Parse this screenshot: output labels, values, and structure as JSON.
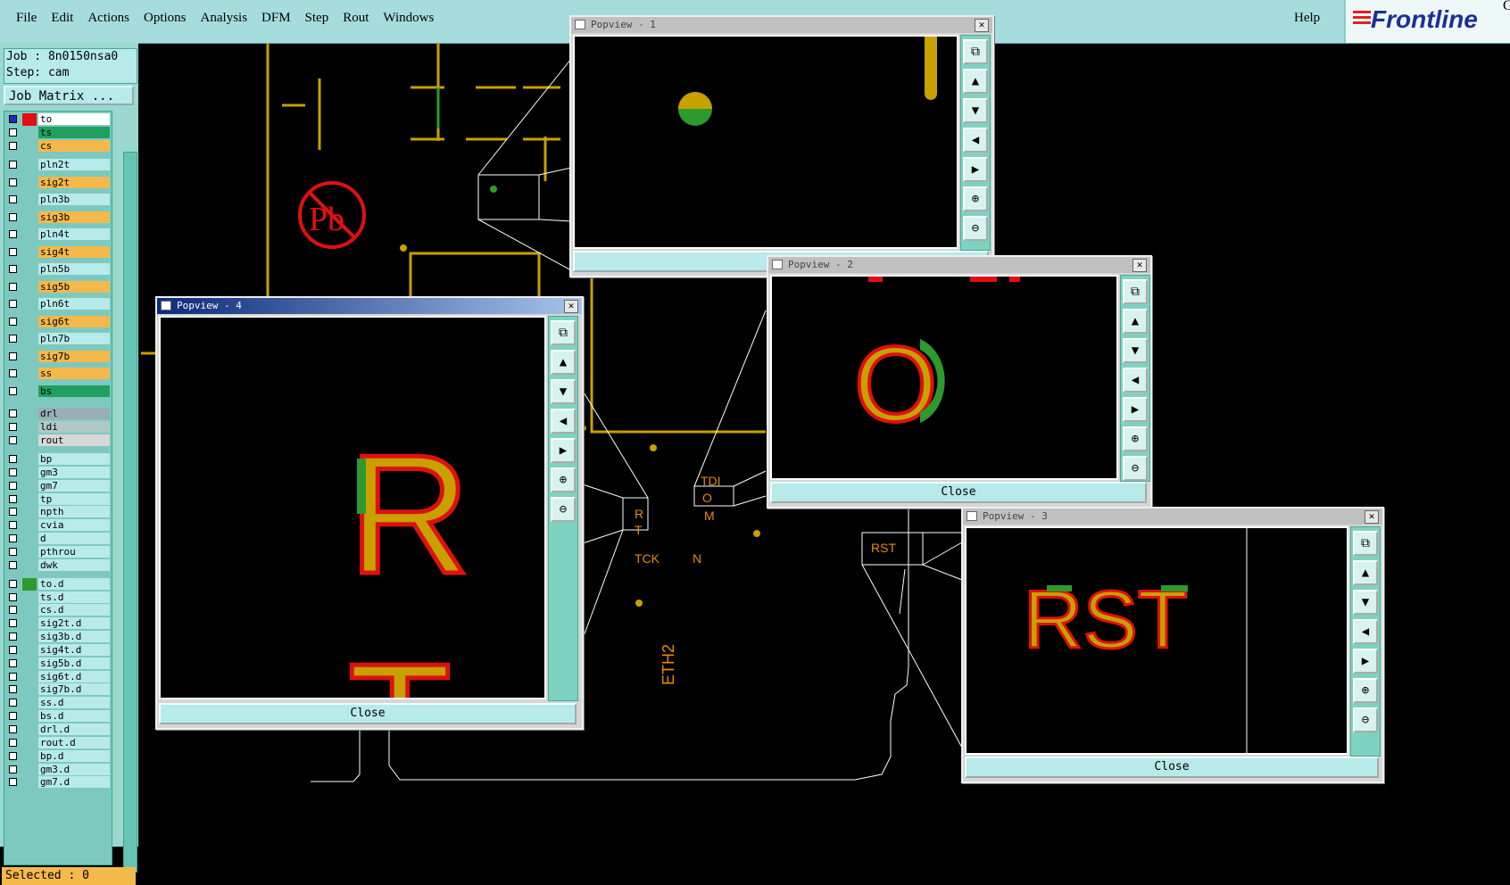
{
  "menu": {
    "items": [
      "File",
      "Edit",
      "Actions",
      "Options",
      "Analysis",
      "DFM",
      "Step",
      "Rout",
      "Windows"
    ],
    "help": "Help"
  },
  "logo": {
    "text": "Frontline",
    "suffix": "G"
  },
  "job": {
    "job": "Job : 8n0150nsa0",
    "step": "Step: cam",
    "matrix_button": "Job Matrix ..."
  },
  "layers": [
    {
      "name": "to",
      "bg": "#ffffff",
      "sw": "#e01010",
      "sel": true
    },
    {
      "name": "ts",
      "bg": "#1fa060",
      "sw": ""
    },
    {
      "name": "cs",
      "bg": "#f5b84a",
      "sw": ""
    },
    {
      "name": "pln2t",
      "bg": "#b8eaea",
      "sw": ""
    },
    {
      "name": "sig2t",
      "bg": "#f5b84a",
      "sw": ""
    },
    {
      "name": "pln3b",
      "bg": "#b8eaea",
      "sw": ""
    },
    {
      "name": "sig3b",
      "bg": "#f5b84a",
      "sw": ""
    },
    {
      "name": "pln4t",
      "bg": "#b8eaea",
      "sw": ""
    },
    {
      "name": "sig4t",
      "bg": "#f5b84a",
      "sw": ""
    },
    {
      "name": "pln5b",
      "bg": "#b8eaea",
      "sw": ""
    },
    {
      "name": "sig5b",
      "bg": "#f5b84a",
      "sw": ""
    },
    {
      "name": "pln6t",
      "bg": "#b8eaea",
      "sw": ""
    },
    {
      "name": "sig6t",
      "bg": "#f5b84a",
      "sw": ""
    },
    {
      "name": "pln7b",
      "bg": "#b8eaea",
      "sw": ""
    },
    {
      "name": "sig7b",
      "bg": "#f5b84a",
      "sw": ""
    },
    {
      "name": "ss",
      "bg": "#f5b84a",
      "sw": ""
    },
    {
      "name": "bs",
      "bg": "#1fa060",
      "sw": ""
    },
    {
      "name": "drl",
      "bg": "#9aaeb8",
      "sw": ""
    },
    {
      "name": "ldi",
      "bg": "#b0c8c8",
      "sw": ""
    },
    {
      "name": "rout",
      "bg": "#d8d8d8",
      "sw": ""
    },
    {
      "name": "bp",
      "bg": "#b8eaea",
      "sw": ""
    },
    {
      "name": "gm3",
      "bg": "#b8eaea",
      "sw": ""
    },
    {
      "name": "gm7",
      "bg": "#b8eaea",
      "sw": ""
    },
    {
      "name": "tp",
      "bg": "#b8eaea",
      "sw": ""
    },
    {
      "name": "npth",
      "bg": "#b8eaea",
      "sw": ""
    },
    {
      "name": "cvia",
      "bg": "#b8eaea",
      "sw": ""
    },
    {
      "name": "d",
      "bg": "#b8eaea",
      "sw": ""
    },
    {
      "name": "pthrou",
      "bg": "#b8eaea",
      "sw": ""
    },
    {
      "name": "dwk",
      "bg": "#b8eaea",
      "sw": ""
    },
    {
      "name": "to.d",
      "bg": "#b8eaea",
      "sw": "#2e9a2e"
    },
    {
      "name": "ts.d",
      "bg": "#b8eaea",
      "sw": ""
    },
    {
      "name": "cs.d",
      "bg": "#b8eaea",
      "sw": ""
    },
    {
      "name": "sig2t.d",
      "bg": "#b8eaea",
      "sw": ""
    },
    {
      "name": "sig3b.d",
      "bg": "#b8eaea",
      "sw": ""
    },
    {
      "name": "sig4t.d",
      "bg": "#b8eaea",
      "sw": ""
    },
    {
      "name": "sig5b.d",
      "bg": "#b8eaea",
      "sw": ""
    },
    {
      "name": "sig6t.d",
      "bg": "#b8eaea",
      "sw": ""
    },
    {
      "name": "sig7b.d",
      "bg": "#b8eaea",
      "sw": ""
    },
    {
      "name": "ss.d",
      "bg": "#b8eaea",
      "sw": ""
    },
    {
      "name": "bs.d",
      "bg": "#b8eaea",
      "sw": ""
    },
    {
      "name": "drl.d",
      "bg": "#b8eaea",
      "sw": ""
    },
    {
      "name": "rout.d",
      "bg": "#b8eaea",
      "sw": ""
    },
    {
      "name": "bp.d",
      "bg": "#b8eaea",
      "sw": ""
    },
    {
      "name": "gm3.d",
      "bg": "#b8eaea",
      "sw": ""
    },
    {
      "name": "gm7.d",
      "bg": "#b8eaea",
      "sw": ""
    }
  ],
  "status": {
    "selected": "Selected : 0"
  },
  "board_labels": {
    "pb": "Pb",
    "tdi": "TDI",
    "o": "O",
    "m": "M",
    "r": "R",
    "t": "T",
    "tck": "TCK",
    "n": "N",
    "eth2": "ETH2",
    "rst": "RST"
  },
  "popviews": {
    "p1": {
      "title": "Popview - 1"
    },
    "p2": {
      "title": "Popview - 2",
      "close": "Close",
      "glyph": "O"
    },
    "p3": {
      "title": "Popview - 3",
      "close": "Close",
      "glyph": "RST"
    },
    "p4": {
      "title": "Popview - 4",
      "close": "Close",
      "glyph_r": "R",
      "glyph_t": "T"
    }
  },
  "colors": {
    "copper": "#c8a000",
    "outline": "#e01010",
    "green": "#2e9a2e",
    "panel": "#a6dcdc"
  }
}
